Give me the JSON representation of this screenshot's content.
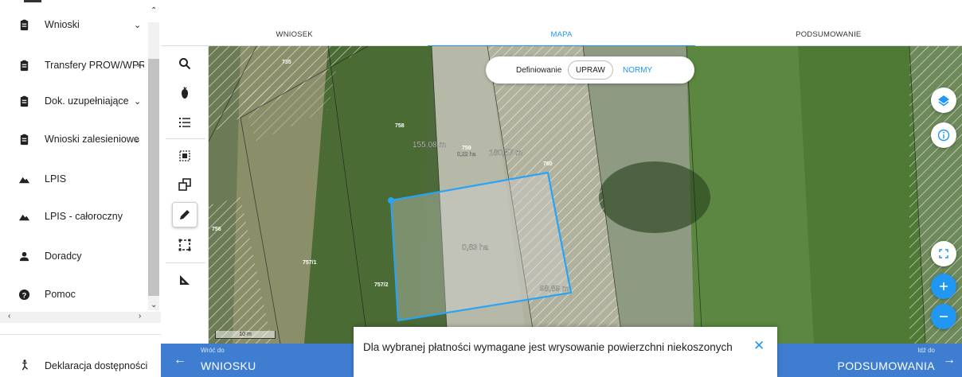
{
  "sidebar": {
    "items": [
      {
        "label": "Wnioski",
        "icon": "clipboard-icon",
        "chevron": "⌄"
      },
      {
        "label": "Transfery PROW/WPR",
        "icon": "clipboard-icon",
        "chevron": "›"
      },
      {
        "label": "Dok. uzupełniające",
        "icon": "clipboard-icon",
        "chevron": "⌄"
      },
      {
        "label": "Wnioski zalesieniowe",
        "icon": "clipboard-icon",
        "chevron": "⌄"
      },
      {
        "label": "LPIS",
        "icon": "terrain-icon",
        "chevron": ""
      },
      {
        "label": "LPIS - całoroczny",
        "icon": "terrain-icon",
        "chevron": ""
      },
      {
        "label": "Doradcy",
        "icon": "person-icon",
        "chevron": ""
      },
      {
        "label": "Pomoc",
        "icon": "help-icon",
        "chevron": ""
      }
    ],
    "footer_link": "Deklaracja dostępności"
  },
  "tabs": [
    {
      "label": "WNIOSEK",
      "active": false
    },
    {
      "label": "MAPA",
      "active": true
    },
    {
      "label": "PODSUMOWANIE",
      "active": false
    }
  ],
  "tools": [
    "search-icon",
    "crop-icon",
    "list-icon",
    "select-parcel-icon",
    "copy-shape-icon",
    "pencil-icon",
    "select-rectangle-icon",
    "measure-icon"
  ],
  "map": {
    "toggle": {
      "label": "Definiowanie",
      "option_a": "UPRAW",
      "option_b": "NORMY"
    },
    "parcel_labels": [
      "735",
      "758",
      "759",
      "760",
      "756",
      "757/1",
      "757/2"
    ],
    "measurements": {
      "edge_left": "155,08 m",
      "edge_right": "180,57 m",
      "small_area": "0,22 ha",
      "area": "0,83 ha",
      "edge_bottom": "98,89 m"
    },
    "scale": "10 m",
    "buttons": [
      "layers-icon",
      "info-icon",
      "fullscreen-icon",
      "zoom-in-icon",
      "zoom-out-icon"
    ]
  },
  "bottom_bar": {
    "back_small": "Wróć do",
    "back_big": "WNIOSKU",
    "next_small": "Idź do",
    "next_big": "PODSUMOWANIA"
  },
  "toast": {
    "message": "Dla wybranej płatności wymagane jest wrysowanie powierzchni niekoszonych",
    "close": "✕"
  },
  "colors": {
    "accent": "#2196f3",
    "bar": "#3f7dd1"
  }
}
